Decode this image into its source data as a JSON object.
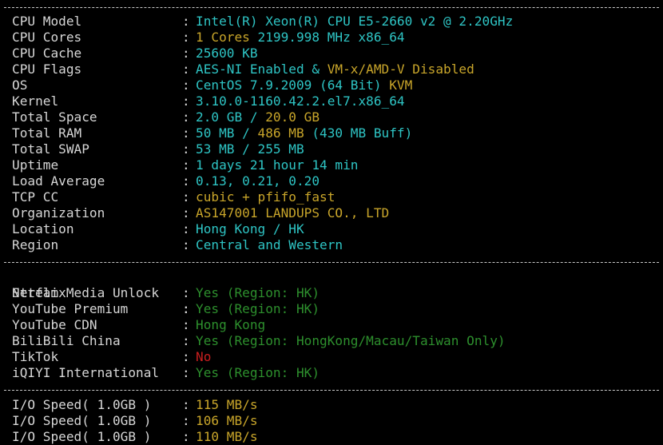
{
  "colors": {
    "background": "#000000",
    "label": "#d6d6d6",
    "cyan": "#2ec4c4",
    "yellow": "#c8a52a",
    "green": "#2d8f2d",
    "red": "#c81e1e"
  },
  "separator": ":",
  "system_info": [
    {
      "label": "CPU Model",
      "segments": [
        {
          "text": "Intel(R) Xeon(R) CPU E5-2660 v2 @ 2.20GHz",
          "color": "cyan"
        }
      ]
    },
    {
      "label": "CPU Cores",
      "segments": [
        {
          "text": "1 Cores ",
          "color": "yellow"
        },
        {
          "text": "2199.998 MHz x86_64",
          "color": "cyan"
        }
      ]
    },
    {
      "label": "CPU Cache",
      "segments": [
        {
          "text": "25600 KB",
          "color": "cyan"
        }
      ]
    },
    {
      "label": "CPU Flags",
      "segments": [
        {
          "text": "AES-NI Enabled & ",
          "color": "cyan"
        },
        {
          "text": "VM-x/AMD-V Disabled",
          "color": "yellow"
        }
      ]
    },
    {
      "label": "OS",
      "segments": [
        {
          "text": "CentOS 7.9.2009 (64 Bit) ",
          "color": "cyan"
        },
        {
          "text": "KVM",
          "color": "yellow"
        }
      ]
    },
    {
      "label": "Kernel",
      "segments": [
        {
          "text": "3.10.0-1160.42.2.el7.x86_64",
          "color": "cyan"
        }
      ]
    },
    {
      "label": "Total Space",
      "segments": [
        {
          "text": "2.0 GB / ",
          "color": "cyan"
        },
        {
          "text": "20.0 GB",
          "color": "yellow"
        }
      ]
    },
    {
      "label": "Total RAM",
      "segments": [
        {
          "text": "50 MB / ",
          "color": "cyan"
        },
        {
          "text": "486 MB ",
          "color": "yellow"
        },
        {
          "text": "(430 MB Buff)",
          "color": "cyan"
        }
      ]
    },
    {
      "label": "Total SWAP",
      "segments": [
        {
          "text": "53 MB / 255 MB",
          "color": "cyan"
        }
      ]
    },
    {
      "label": "Uptime",
      "segments": [
        {
          "text": "1 days 21 hour 14 min",
          "color": "cyan"
        }
      ]
    },
    {
      "label": "Load Average",
      "segments": [
        {
          "text": "0.13, 0.21, 0.20",
          "color": "cyan"
        }
      ]
    },
    {
      "label": "TCP CC",
      "segments": [
        {
          "text": "cubic + pfifo_fast",
          "color": "yellow"
        }
      ]
    },
    {
      "label": "Organization",
      "segments": [
        {
          "text": "AS147001 LANDUPS CO., LTD",
          "color": "yellow"
        }
      ]
    },
    {
      "label": "Location",
      "segments": [
        {
          "text": "Hong Kong / HK",
          "color": "cyan"
        }
      ]
    },
    {
      "label": "Region",
      "segments": [
        {
          "text": "Central and Western",
          "color": "cyan"
        }
      ]
    }
  ],
  "stream_media": {
    "header": "Stream Media Unlock",
    "items": [
      {
        "label": "Netflix",
        "segments": [
          {
            "text": "Yes (Region: HK)",
            "color": "green"
          }
        ]
      },
      {
        "label": "YouTube Premium",
        "segments": [
          {
            "text": "Yes (Region: HK)",
            "color": "green"
          }
        ]
      },
      {
        "label": "YouTube CDN",
        "segments": [
          {
            "text": "Hong Kong",
            "color": "green"
          }
        ]
      },
      {
        "label": "BiliBili China",
        "segments": [
          {
            "text": "Yes (Region: HongKong/Macau/Taiwan Only)",
            "color": "green"
          }
        ]
      },
      {
        "label": "TikTok",
        "segments": [
          {
            "text": "No",
            "color": "red"
          }
        ]
      },
      {
        "label": "iQIYI International",
        "segments": [
          {
            "text": "Yes (Region: HK)",
            "color": "green"
          }
        ]
      }
    ]
  },
  "io_speed": [
    {
      "label": "I/O Speed( 1.0GB )",
      "segments": [
        {
          "text": "115 MB/s",
          "color": "yellow"
        }
      ]
    },
    {
      "label": "I/O Speed( 1.0GB )",
      "segments": [
        {
          "text": "106 MB/s",
          "color": "yellow"
        }
      ]
    },
    {
      "label": "I/O Speed( 1.0GB )",
      "segments": [
        {
          "text": "110 MB/s",
          "color": "yellow"
        }
      ]
    }
  ]
}
